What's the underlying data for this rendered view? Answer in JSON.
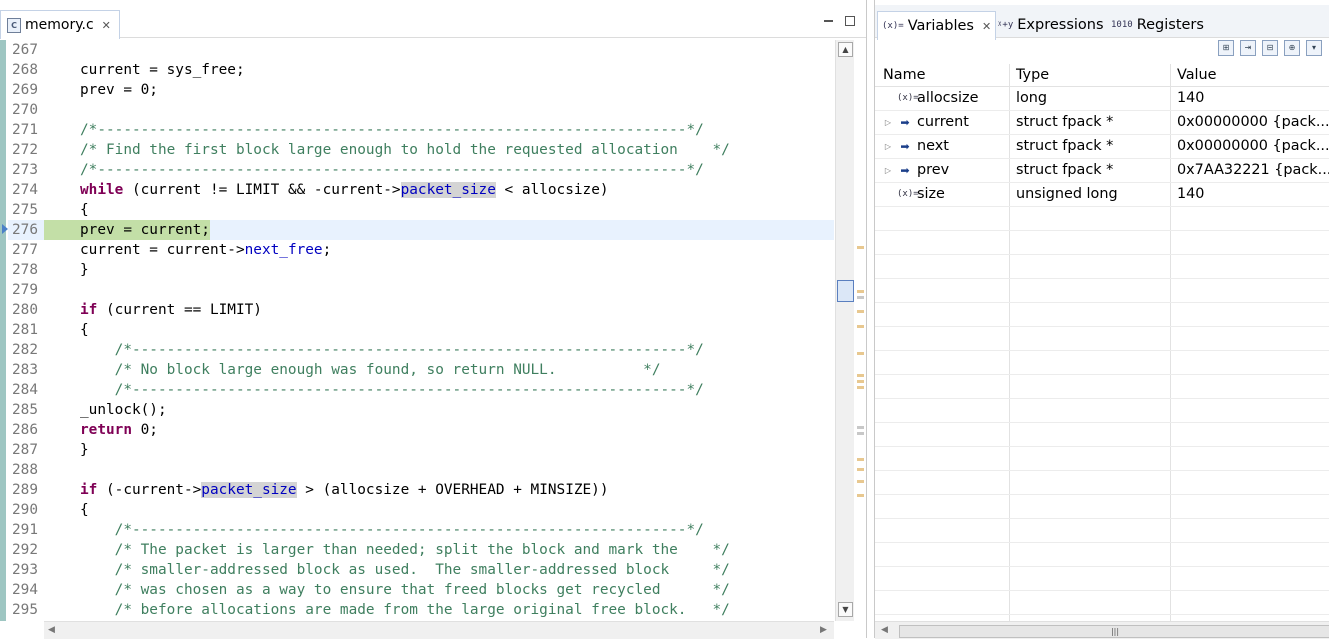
{
  "editor": {
    "tab_label": "memory.c",
    "file_icon": "C",
    "lines": [
      {
        "n": "267",
        "code": ""
      },
      {
        "n": "268",
        "code": "current = sys_free;"
      },
      {
        "n": "269",
        "code": "prev = 0;"
      },
      {
        "n": "270",
        "code": ""
      },
      {
        "n": "271",
        "code": "/*--------------------------------------------------------------------*/"
      },
      {
        "n": "272",
        "code": "/* Find the first block large enough to hold the requested allocation    */"
      },
      {
        "n": "273",
        "code": "/*--------------------------------------------------------------------*/"
      },
      {
        "n": "274",
        "code": "while (current != LIMIT && -current->packet_size < allocsize)"
      },
      {
        "n": "275",
        "code": "{"
      },
      {
        "n": "276",
        "code": "prev = current;"
      },
      {
        "n": "277",
        "code": "current = current->next_free;"
      },
      {
        "n": "278",
        "code": "}"
      },
      {
        "n": "279",
        "code": ""
      },
      {
        "n": "280",
        "code": "if (current == LIMIT)"
      },
      {
        "n": "281",
        "code": "{"
      },
      {
        "n": "282",
        "code": "    /*----------------------------------------------------------------*/"
      },
      {
        "n": "283",
        "code": "    /* No block large enough was found, so return NULL.          */"
      },
      {
        "n": "284",
        "code": "    /*----------------------------------------------------------------*/"
      },
      {
        "n": "285",
        "code": "_unlock();"
      },
      {
        "n": "286",
        "code": "return 0;"
      },
      {
        "n": "287",
        "code": "}"
      },
      {
        "n": "288",
        "code": ""
      },
      {
        "n": "289",
        "code": "if (-current->packet_size > (allocsize + OVERHEAD + MINSIZE))"
      },
      {
        "n": "290",
        "code": "{"
      },
      {
        "n": "291",
        "code": "    /*----------------------------------------------------------------*/"
      },
      {
        "n": "292",
        "code": "    /* The packet is larger than needed; split the block and mark the    */"
      },
      {
        "n": "293",
        "code": "    /* smaller-addressed block as used.  The smaller-addressed block     */"
      },
      {
        "n": "294",
        "code": "    /* was chosen as a way to ensure that freed blocks get recycled      */"
      },
      {
        "n": "295",
        "code": "    /* before allocations are made from the large original free block.   */"
      }
    ],
    "current_line": "276"
  },
  "variables_view": {
    "tabs": [
      {
        "label": "Variables",
        "icon": "(x)=",
        "active": true
      },
      {
        "label": "Expressions",
        "icon": "expressions-icon",
        "active": false
      },
      {
        "label": "Registers",
        "icon": "1010",
        "active": false
      }
    ],
    "columns": [
      "Name",
      "Type",
      "Value"
    ],
    "rows": [
      {
        "name": "allocsize",
        "type": "long",
        "value": "140",
        "kind": "primitive",
        "expandable": false
      },
      {
        "name": "current",
        "type": "struct fpack *",
        "value": "0x00000000 {pack...",
        "kind": "pointer",
        "expandable": true
      },
      {
        "name": "next",
        "type": "struct fpack *",
        "value": "0x00000000 {pack...",
        "kind": "pointer",
        "expandable": true
      },
      {
        "name": "prev",
        "type": "struct fpack *",
        "value": "0x7AA32221 {pack...",
        "kind": "pointer",
        "expandable": true
      },
      {
        "name": "size",
        "type": "unsigned long",
        "value": "140",
        "kind": "primitive",
        "expandable": false
      }
    ]
  },
  "colors": {
    "keyword": "#7f0055",
    "comment": "#3f7f5f",
    "field": "#0000c0",
    "current_line_bg": "#e8f2fe",
    "current_stmt_bg": "#c3dfa7",
    "occurrence_bg": "#d4d4d4"
  }
}
